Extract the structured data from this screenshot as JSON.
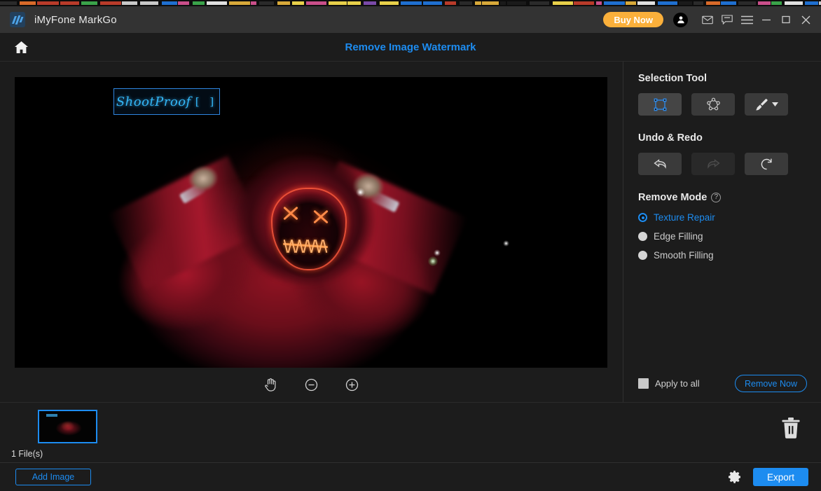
{
  "titlebar": {
    "app_name": "iMyFone MarkGo",
    "logo_icon": "markgo-logo-icon",
    "buy_now_label": "Buy Now",
    "account_icon": "account-avatar-icon",
    "mail_icon": "mail-icon",
    "feedback_icon": "chat-feedback-icon",
    "menu_icon": "hamburger-menu-icon",
    "minimize_icon": "minimize-icon",
    "maximize_icon": "maximize-icon",
    "close_icon": "close-icon"
  },
  "navbar": {
    "home_icon": "home-icon",
    "page_title": "Remove Image Watermark"
  },
  "canvas": {
    "watermark_text": "ShootProof",
    "watermark_brackets": "[ ]",
    "selection_color": "#2f86e0",
    "tools": [
      {
        "name": "pan-hand-icon",
        "label": "Pan"
      },
      {
        "name": "zoom-out-icon",
        "label": "Zoom out"
      },
      {
        "name": "zoom-in-icon",
        "label": "Zoom in"
      }
    ]
  },
  "panel": {
    "selection_tool": {
      "title": "Selection Tool",
      "items": [
        {
          "name": "rectangle-select-icon",
          "label": "Rectangle Select",
          "active": true
        },
        {
          "name": "polygon-select-icon",
          "label": "Polygon Select",
          "active": false
        },
        {
          "name": "brush-select-icon",
          "label": "Brush Select",
          "active": false,
          "has_dropdown": true
        }
      ]
    },
    "undo_redo": {
      "title": "Undo & Redo",
      "items": [
        {
          "name": "undo-icon",
          "label": "Undo",
          "disabled": false
        },
        {
          "name": "redo-icon",
          "label": "Redo",
          "disabled": true
        },
        {
          "name": "reset-icon",
          "label": "Reset",
          "disabled": false
        }
      ]
    },
    "remove_mode": {
      "title": "Remove Mode",
      "help_icon": "help-question-icon",
      "options": [
        {
          "label": "Texture Repair",
          "selected": true
        },
        {
          "label": "Edge Filling",
          "selected": false
        },
        {
          "label": "Smooth Filling",
          "selected": false
        }
      ]
    },
    "apply_to_all_label": "Apply to all",
    "apply_to_all_checked": false,
    "remove_now_label": "Remove Now"
  },
  "strip": {
    "file_count": "1 File(s)",
    "delete_icon": "trash-delete-icon"
  },
  "footer": {
    "add_image_label": "Add Image",
    "settings_icon": "gear-settings-icon",
    "export_label": "Export"
  },
  "colors": {
    "accent_blue": "#1d8cf0",
    "buy_now_orange": "#fbb03b",
    "panel_bg": "#1c1c1c",
    "titlebar_bg": "#333333"
  }
}
